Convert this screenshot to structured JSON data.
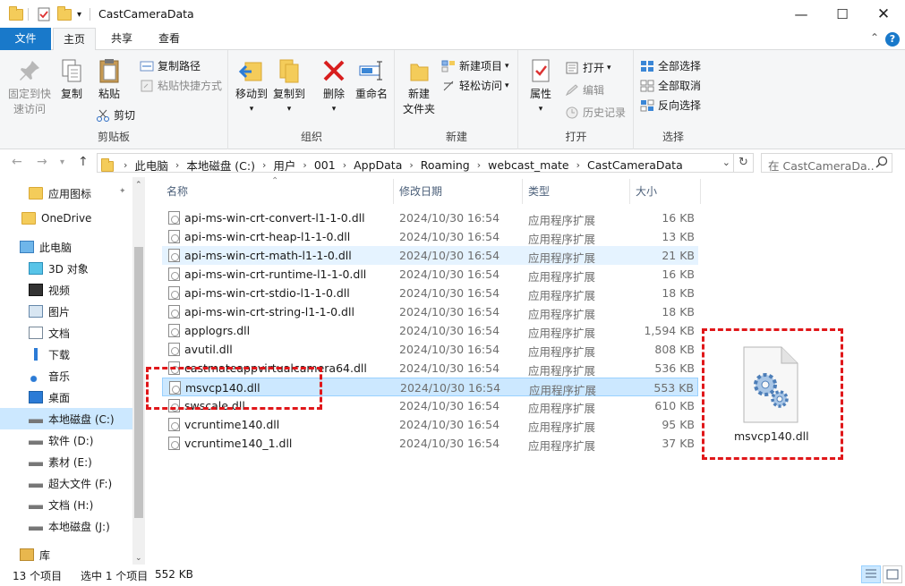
{
  "window": {
    "title": "CastCameraData"
  },
  "tabs": {
    "file": "文件",
    "home": "主页",
    "share": "共享",
    "view": "查看"
  },
  "ribbon": {
    "clipboard": {
      "label": "剪贴板",
      "pin_line1": "固定到快",
      "pin_line2": "速访问",
      "copy": "复制",
      "paste": "粘贴",
      "copy_path": "复制路径",
      "paste_shortcut": "粘贴快捷方式",
      "cut": "剪切"
    },
    "organize": {
      "label": "组织",
      "move_to": "移动到",
      "copy_to": "复制到",
      "delete": "删除",
      "rename": "重命名"
    },
    "new": {
      "label": "新建",
      "new_folder_line1": "新建",
      "new_folder_line2": "文件夹",
      "new_item": "新建项目",
      "easy_access": "轻松访问"
    },
    "open": {
      "label": "打开",
      "properties": "属性",
      "open": "打开",
      "edit": "编辑",
      "history": "历史记录"
    },
    "select": {
      "label": "选择",
      "select_all": "全部选择",
      "select_none": "全部取消",
      "invert": "反向选择"
    }
  },
  "address": {
    "crumbs": [
      "此电脑",
      "本地磁盘 (C:)",
      "用户",
      "001",
      "AppData",
      "Roaming",
      "webcast_mate",
      "CastCameraData"
    ]
  },
  "search": {
    "placeholder": "在 CastCameraDa..."
  },
  "navpane": {
    "items": [
      {
        "label": "应用图标",
        "icon": "folder-icon"
      },
      {
        "label": "OneDrive",
        "icon": "folder-icon"
      },
      {
        "label": "此电脑",
        "icon": "computer-icon"
      },
      {
        "label": "3D 对象",
        "icon": "3d-objects-icon"
      },
      {
        "label": "视频",
        "icon": "video-icon"
      },
      {
        "label": "图片",
        "icon": "pictures-icon"
      },
      {
        "label": "文档",
        "icon": "documents-icon"
      },
      {
        "label": "下载",
        "icon": "download-icon"
      },
      {
        "label": "音乐",
        "icon": "music-icon"
      },
      {
        "label": "桌面",
        "icon": "desktop-icon"
      },
      {
        "label": "本地磁盘 (C:)",
        "icon": "drive-icon"
      },
      {
        "label": "软件 (D:)",
        "icon": "drive-icon"
      },
      {
        "label": "素材 (E:)",
        "icon": "drive-icon"
      },
      {
        "label": "超大文件 (F:)",
        "icon": "drive-icon"
      },
      {
        "label": "文档 (H:)",
        "icon": "drive-icon"
      },
      {
        "label": "本地磁盘 (J:)",
        "icon": "drive-icon"
      },
      {
        "label": "库",
        "icon": "library-icon"
      }
    ]
  },
  "columns": {
    "name": "名称",
    "modified": "修改日期",
    "type": "类型",
    "size": "大小"
  },
  "files": [
    {
      "name": "api-ms-win-crt-convert-l1-1-0.dll",
      "date": "2024/10/30 16:54",
      "type": "应用程序扩展",
      "size": "16 KB"
    },
    {
      "name": "api-ms-win-crt-heap-l1-1-0.dll",
      "date": "2024/10/30 16:54",
      "type": "应用程序扩展",
      "size": "13 KB"
    },
    {
      "name": "api-ms-win-crt-math-l1-1-0.dll",
      "date": "2024/10/30 16:54",
      "type": "应用程序扩展",
      "size": "21 KB"
    },
    {
      "name": "api-ms-win-crt-runtime-l1-1-0.dll",
      "date": "2024/10/30 16:54",
      "type": "应用程序扩展",
      "size": "16 KB"
    },
    {
      "name": "api-ms-win-crt-stdio-l1-1-0.dll",
      "date": "2024/10/30 16:54",
      "type": "应用程序扩展",
      "size": "18 KB"
    },
    {
      "name": "api-ms-win-crt-string-l1-1-0.dll",
      "date": "2024/10/30 16:54",
      "type": "应用程序扩展",
      "size": "18 KB"
    },
    {
      "name": "applogrs.dll",
      "date": "2024/10/30 16:54",
      "type": "应用程序扩展",
      "size": "1,594 KB"
    },
    {
      "name": "avutil.dll",
      "date": "2024/10/30 16:54",
      "type": "应用程序扩展",
      "size": "808 KB"
    },
    {
      "name": "castmateappvirtualcamera64.dll",
      "date": "2024/10/30 16:54",
      "type": "应用程序扩展",
      "size": "536 KB"
    },
    {
      "name": "msvcp140.dll",
      "date": "2024/10/30 16:54",
      "type": "应用程序扩展",
      "size": "553 KB"
    },
    {
      "name": "swscale.dll",
      "date": "2024/10/30 16:54",
      "type": "应用程序扩展",
      "size": "610 KB"
    },
    {
      "name": "vcruntime140.dll",
      "date": "2024/10/30 16:54",
      "type": "应用程序扩展",
      "size": "95 KB"
    },
    {
      "name": "vcruntime140_1.dll",
      "date": "2024/10/30 16:54",
      "type": "应用程序扩展",
      "size": "37 KB"
    }
  ],
  "preview": {
    "filename": "msvcp140.dll"
  },
  "status": {
    "count": "13 个项目",
    "selected": "选中 1 个项目",
    "size": "552 KB"
  },
  "colors": {
    "accent": "#1979ca",
    "selection": "#cce8ff",
    "annotation": "#e0171a"
  }
}
